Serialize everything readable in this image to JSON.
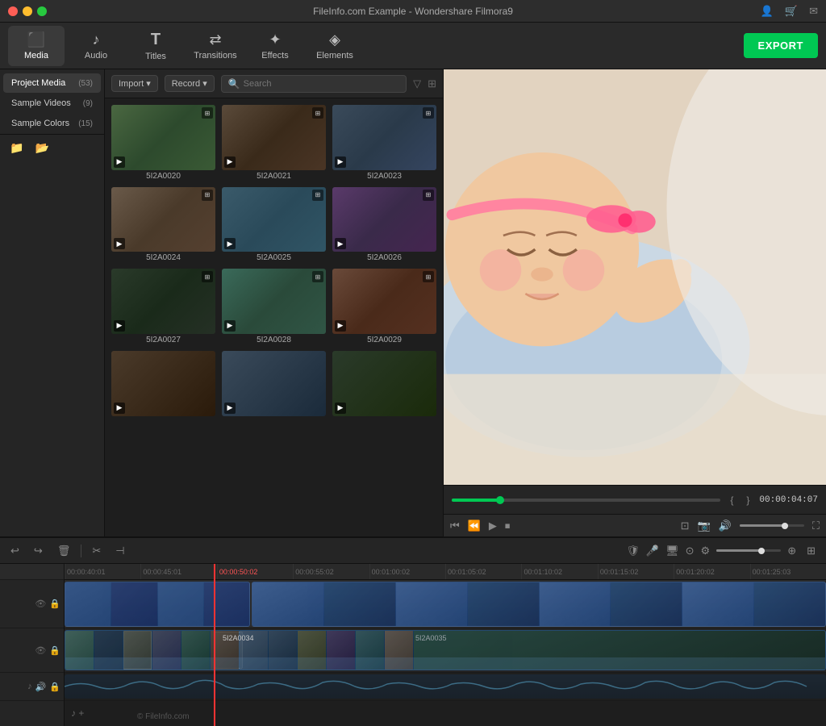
{
  "app": {
    "title": "FileInfo.com Example - Wondershare Filmora9",
    "export_label": "EXPORT"
  },
  "nav": {
    "items": [
      {
        "id": "media",
        "label": "Media",
        "icon": "🎬",
        "active": true
      },
      {
        "id": "audio",
        "label": "Audio",
        "icon": "🎵",
        "active": false
      },
      {
        "id": "titles",
        "label": "Titles",
        "icon": "T",
        "active": false
      },
      {
        "id": "transitions",
        "label": "Transitions",
        "icon": "⇄",
        "active": false
      },
      {
        "id": "effects",
        "label": "Effects",
        "icon": "✦",
        "active": false
      },
      {
        "id": "elements",
        "label": "Elements",
        "icon": "◈",
        "active": false
      }
    ]
  },
  "sidebar": {
    "items": [
      {
        "label": "Project Media",
        "count": "53",
        "active": true
      },
      {
        "label": "Sample Videos",
        "count": "9",
        "active": false
      },
      {
        "label": "Sample Colors",
        "count": "15",
        "active": false
      }
    ]
  },
  "media_toolbar": {
    "import_label": "Import",
    "record_label": "Record",
    "search_placeholder": "Search"
  },
  "media_grid": {
    "items": [
      {
        "id": "5I2A0020",
        "color": "c1"
      },
      {
        "id": "5I2A0021",
        "color": "c2"
      },
      {
        "id": "5I2A0023",
        "color": "c3"
      },
      {
        "id": "5I2A0024",
        "color": "c4"
      },
      {
        "id": "5I2A0025",
        "color": "c5"
      },
      {
        "id": "5I2A0026",
        "color": "c6"
      },
      {
        "id": "5I2A0027",
        "color": "c7"
      },
      {
        "id": "5I2A0028",
        "color": "c8"
      },
      {
        "id": "5I2A0029",
        "color": "c9"
      }
    ]
  },
  "preview": {
    "time_current": "00:00:04:07",
    "bracket_open": "{",
    "bracket_close": "}"
  },
  "timeline": {
    "ruler_marks": [
      "00:00:40:01",
      "00:00:45:01",
      "00:00:50:02",
      "00:00:55:02",
      "00:01:00:02",
      "00:01:05:02",
      "00:01:10:02",
      "00:01:15:02",
      "00:01:20:02",
      "00:01:25:03"
    ],
    "clip_labels": [
      "5I2A0034",
      "5I2A0035"
    ]
  },
  "copyright": "© FileInfo.com"
}
